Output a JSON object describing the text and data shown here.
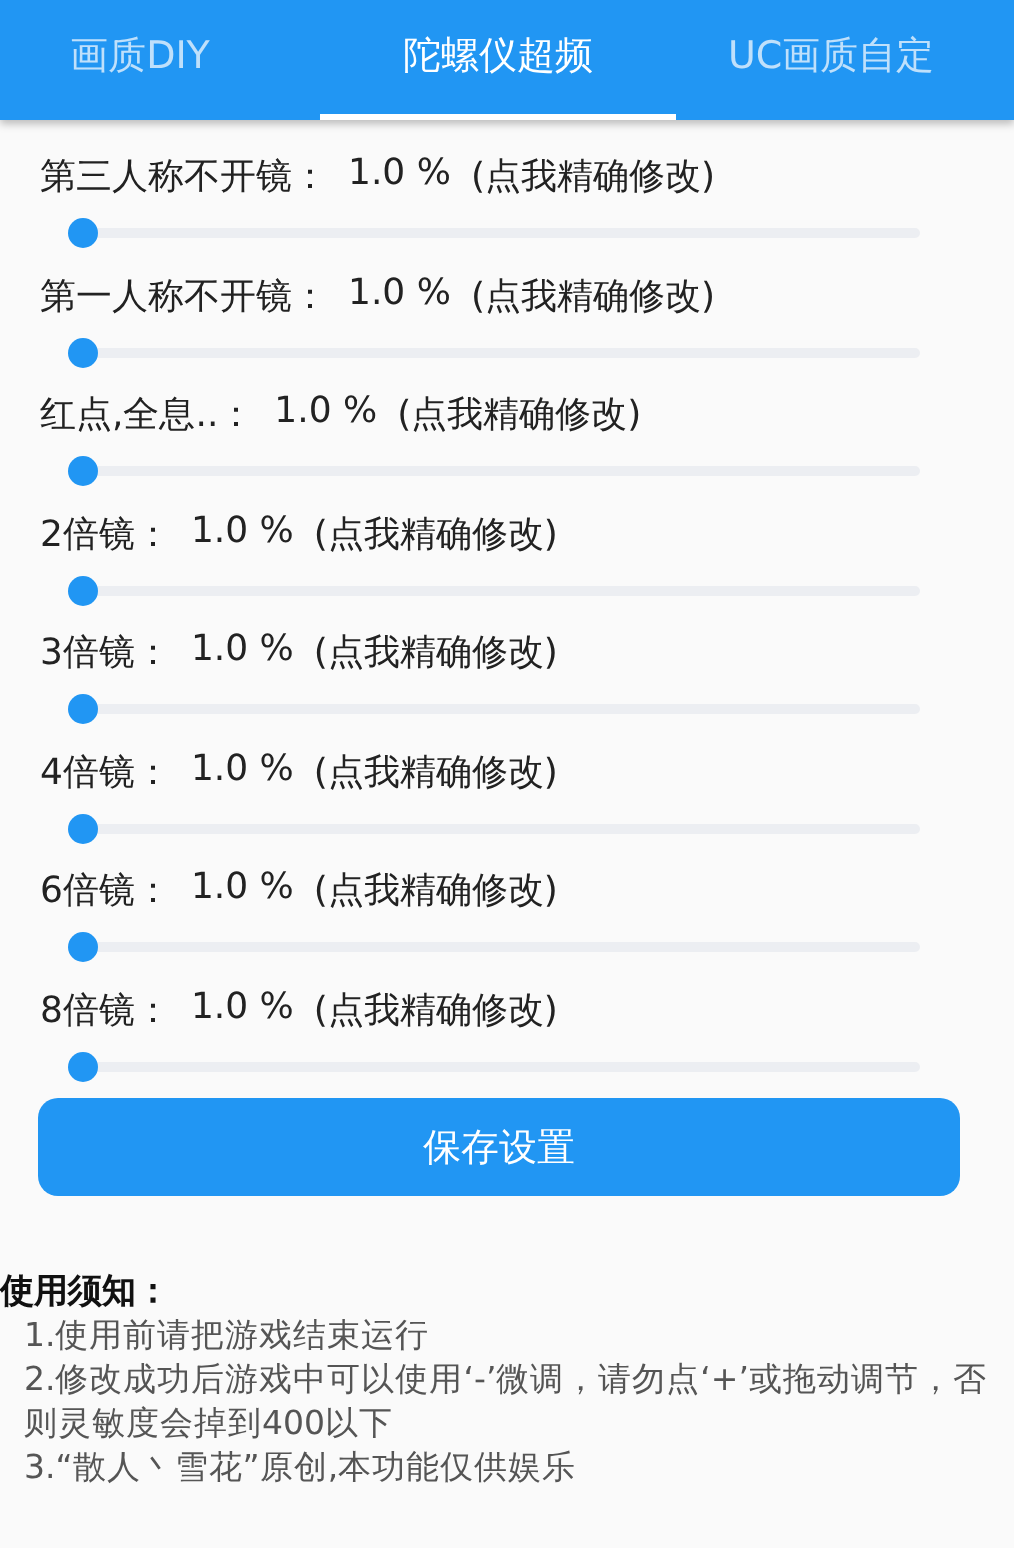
{
  "tabs": [
    {
      "label": "画质DIY",
      "selected": false
    },
    {
      "label": "陀螺仪超频",
      "selected": true
    },
    {
      "label": "UC画质自定",
      "selected": false
    }
  ],
  "sliders": [
    {
      "name": "第三人称不开镜：",
      "value": "1.0 %",
      "hint": "(点我精确修改)",
      "level": 0
    },
    {
      "name": "第一人称不开镜：",
      "value": "1.0 %",
      "hint": "(点我精确修改)",
      "level": 0
    },
    {
      "name": "红点,全息..：",
      "value": "1.0 %",
      "hint": "(点我精确修改)",
      "level": 0
    },
    {
      "name": "2倍镜：",
      "value": "1.0 %",
      "hint": "(点我精确修改)",
      "level": 0
    },
    {
      "name": "3倍镜：",
      "value": "1.0 %",
      "hint": "(点我精确修改)",
      "level": 0
    },
    {
      "name": "4倍镜：",
      "value": "1.0 %",
      "hint": "(点我精确修改)",
      "level": 0
    },
    {
      "name": "6倍镜：",
      "value": "1.0 %",
      "hint": "(点我精确修改)",
      "level": 0
    },
    {
      "name": "8倍镜：",
      "value": "1.0 %",
      "hint": "(点我精确修改)",
      "level": 0
    }
  ],
  "save_button": "保存设置",
  "notes": {
    "title": "使用须知：",
    "items": [
      "1.使用前请把游戏结束运行",
      "2.修改成功后游戏中可以使用‘-’微调，请勿点‘+’或拖动调节，否则灵敏度会掉到400以下",
      "3.“散人丶雪花”原创,本功能仅供娱乐"
    ]
  }
}
